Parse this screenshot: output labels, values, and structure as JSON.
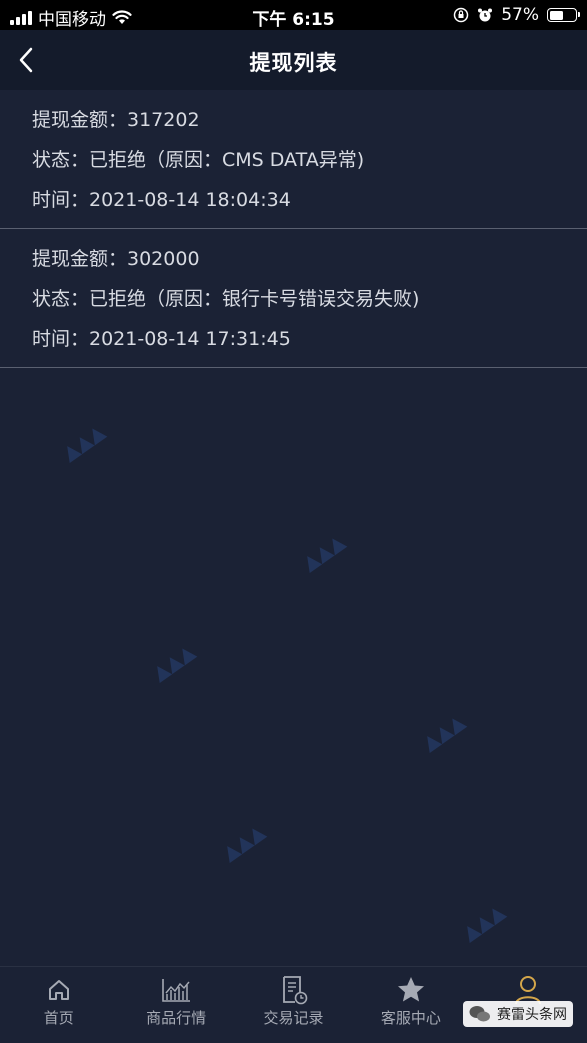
{
  "status_bar": {
    "carrier": "中国移动",
    "time": "下午 6:15",
    "battery": "57%",
    "battery_level": 0.57
  },
  "nav": {
    "title": "提现列表"
  },
  "records": [
    {
      "amount": "提现金额：317202",
      "status": "状态：已拒绝（原因：CMS DATA异常)",
      "time": "时间：2021-08-14 18:04:34"
    },
    {
      "amount": "提现金额：302000",
      "status": "状态：已拒绝（原因：银行卡号错误交易失败)",
      "time": "时间：2021-08-14 17:31:45"
    }
  ],
  "tabs": [
    {
      "label": "首页",
      "icon": "home-icon"
    },
    {
      "label": "商品行情",
      "icon": "chart-icon"
    },
    {
      "label": "交易记录",
      "icon": "document-clock-icon"
    },
    {
      "label": "客服中心",
      "icon": "star-icon"
    },
    {
      "label": "",
      "icon": "user-icon"
    }
  ],
  "colors": {
    "background": "#1b2235",
    "nav_background": "#141b2b",
    "active_tab": "#d4a64a"
  },
  "corner_logo": {
    "text": "赛雷头条网"
  }
}
